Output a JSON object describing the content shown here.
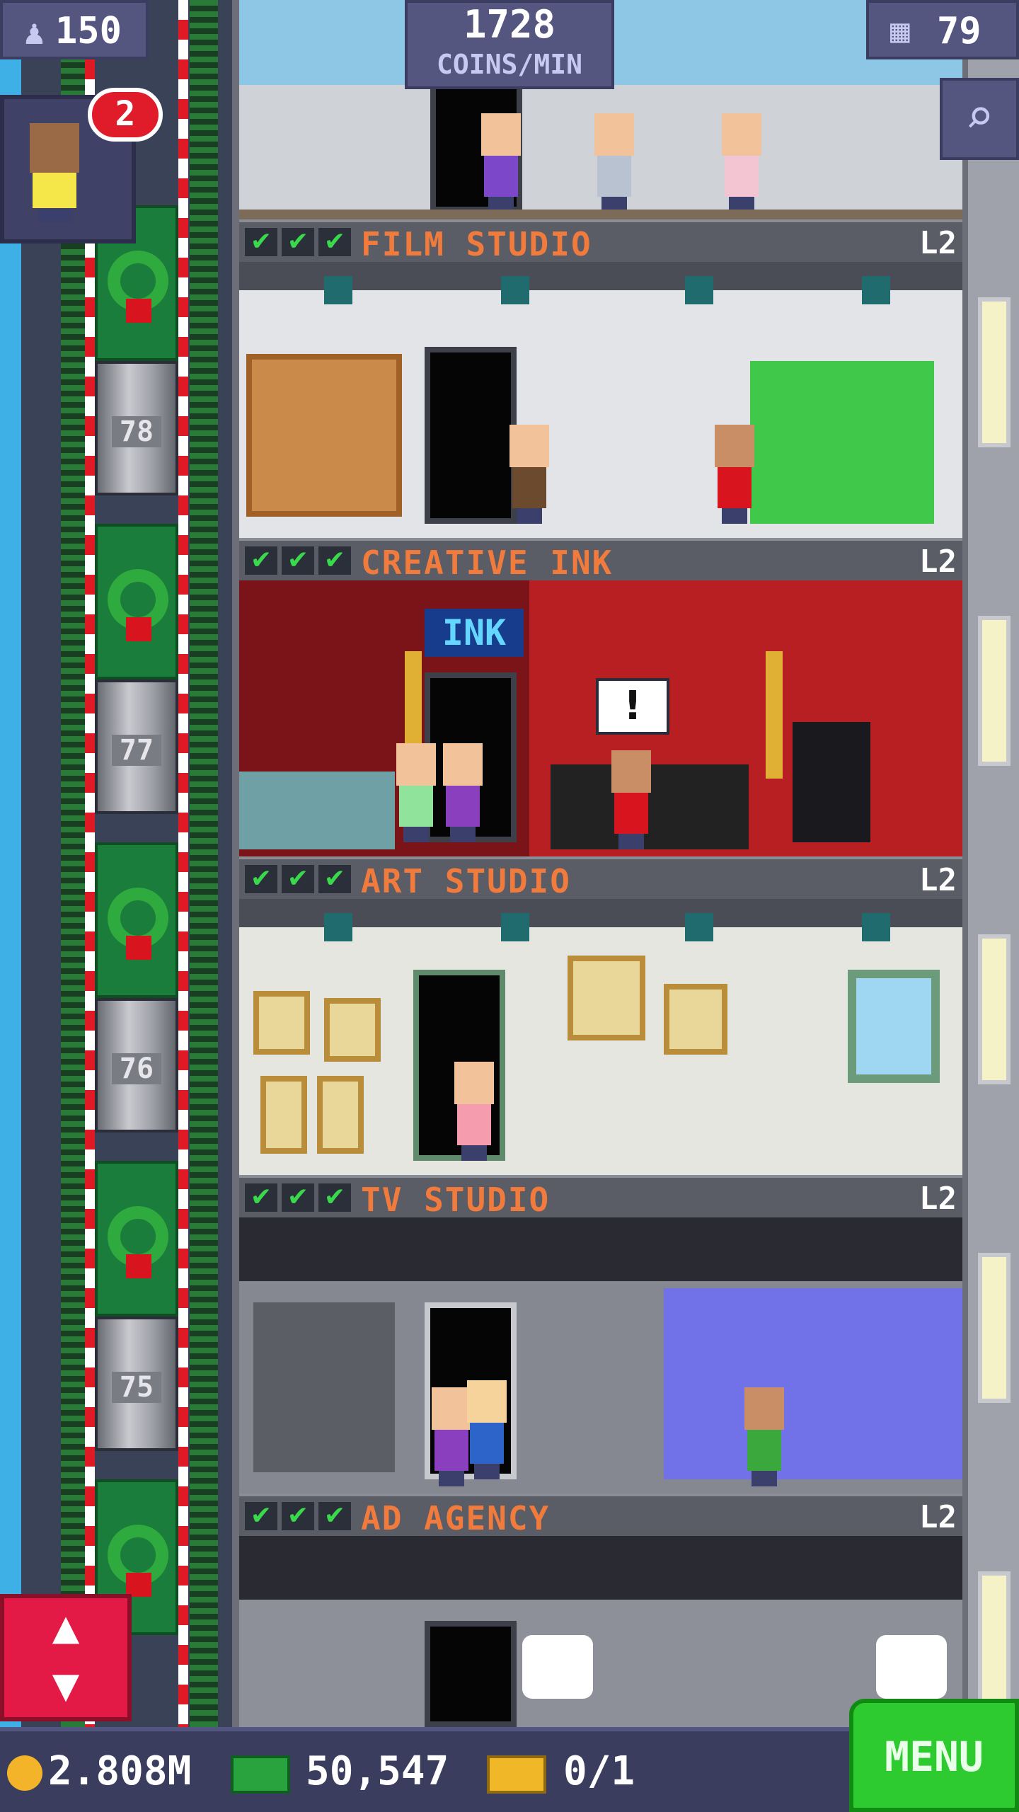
{
  "hud": {
    "population": "150",
    "coins_per_min_value": "1728",
    "coins_per_min_label": "COINS/MIN",
    "floors": "79",
    "visitor_badge": "2"
  },
  "elevator": {
    "floor_numbers": [
      "78",
      "77",
      "76",
      "75"
    ]
  },
  "floors": [
    {
      "name": "FILM STUDIO",
      "level": "L2",
      "checks": [
        "✔",
        "✔",
        "✔"
      ]
    },
    {
      "name": "CREATIVE INK",
      "level": "L2",
      "checks": [
        "✔",
        "✔",
        "✔"
      ]
    },
    {
      "name": "ART STUDIO",
      "level": "L2",
      "checks": [
        "✔",
        "✔",
        "✔"
      ]
    },
    {
      "name": "TV STUDIO",
      "level": "L2",
      "checks": [
        "✔",
        "✔",
        "✔"
      ]
    },
    {
      "name": "AD AGENCY",
      "level": "L2",
      "checks": [
        "✔",
        "✔",
        "✔"
      ]
    }
  ],
  "ink_sign": "INK",
  "speech_bubble": "!",
  "bottom": {
    "coins": "2.808M",
    "bux": "50,547",
    "vip": "0/1",
    "menu_label": "MENU"
  },
  "icons": {
    "population": "person-icon",
    "floors": "building-icon",
    "search": "magnifier-icon",
    "elevator": "up-down-arrows-icon"
  },
  "colors": {
    "floor_label_text": "#f07b3c",
    "check_green": "#3ad94c",
    "menu_green": "#2dcb2f",
    "elevator_button": "#e21a45",
    "hud_bg": "#545680"
  }
}
